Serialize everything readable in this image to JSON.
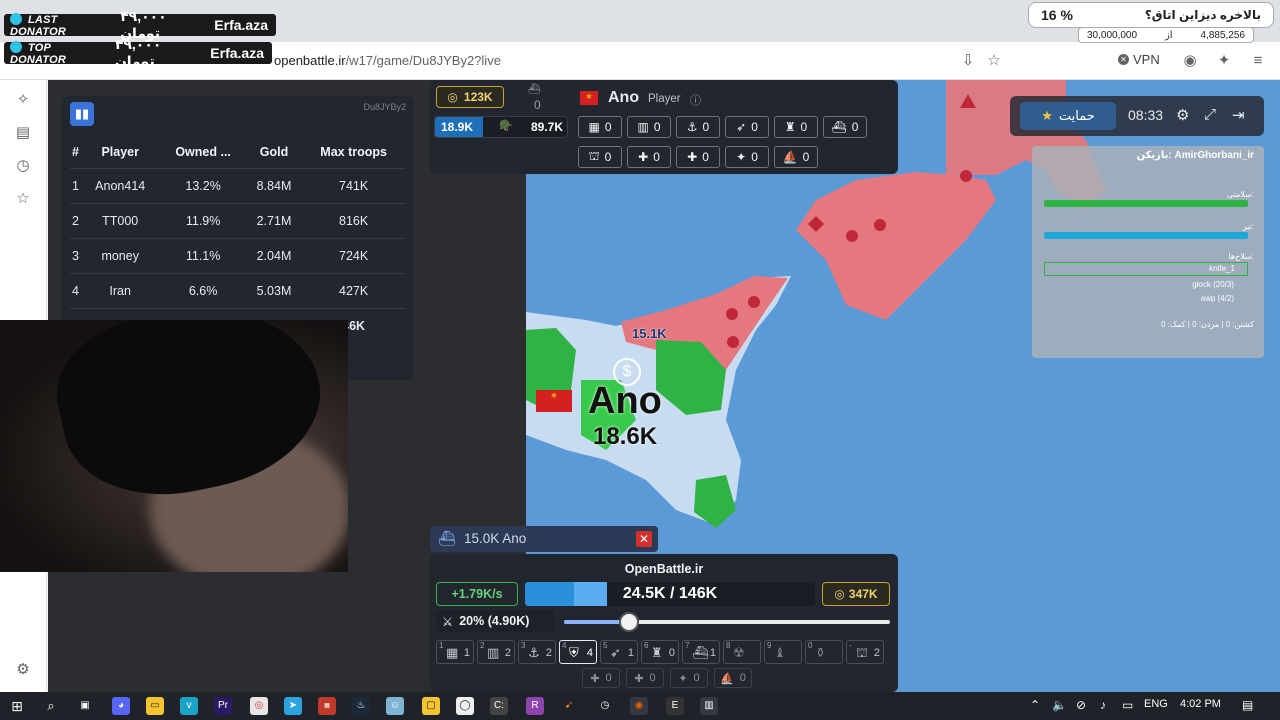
{
  "overlays": {
    "last_donator": {
      "tag": "LAST DONATOR",
      "amount": "۴۹,۰۰۰ تومان",
      "name": "Erfa.aza"
    },
    "top_donator": {
      "tag": "TOP DONATOR",
      "amount": "۴۹,۰۰۰ تومان",
      "name": "Erfa.aza"
    },
    "goal": {
      "title": "بالاخره دیزاین اتاق؟",
      "percent": "16 %",
      "current": "4,885,256",
      "of": "از",
      "target": "30,000,000"
    }
  },
  "browser": {
    "url_host": "openbattle.ir",
    "url_path": "/w17/game/Du8JYBy2?live",
    "vpn_label": "VPN"
  },
  "leaderboard": {
    "game_id": "Du8JYBy2",
    "headers": [
      "#",
      "Player",
      "Owned ...",
      "Gold",
      "Max troops"
    ],
    "rows": [
      [
        "1",
        "Anon414",
        "13.2%",
        "8.84M",
        "741K"
      ],
      [
        "2",
        "TT000",
        "11.9%",
        "2.71M",
        "816K"
      ],
      [
        "3",
        "money",
        "11.1%",
        "2.04M",
        "724K"
      ],
      [
        "4",
        "Iran",
        "6.6%",
        "5.03M",
        "427K"
      ],
      [
        "",
        "",
        "",
        "",
        "46K"
      ]
    ]
  },
  "player_info": {
    "gold": "123K",
    "boat_count": "0",
    "name": "Ano",
    "type": "Player",
    "troops_left": "18.9K",
    "troops_right": "89.7K",
    "buildings_row1": [
      "0",
      "0",
      "0",
      "0",
      "0",
      "0"
    ],
    "buildings_row2": [
      "0",
      "0",
      "0",
      "0",
      "0"
    ]
  },
  "map": {
    "player_name": "Ano",
    "player_troops": "18.6K",
    "small_troop": "15.1K"
  },
  "right_panel": {
    "player": "بازیکن: AmirGhorbani_ir",
    "health_label": "سلامتی:",
    "ammo_label": "تیر:",
    "weapons_label": "سلاح‌ها:",
    "weapon_selected": "knife_1",
    "weapon2": "glock (20/3)",
    "weapon3": "awp (4/2)",
    "stats": "کشتن: 0 | مردن: 0 | کمک: 0"
  },
  "controls": {
    "support_label": "حمایت",
    "timer": "08:33"
  },
  "attack": {
    "amount": "15.0K",
    "target": "Ano"
  },
  "bottom": {
    "brand": "OpenBattle.ir",
    "rate": "+1.79K/s",
    "troops": "24.5K / 146K",
    "troop_fraction": 0.168,
    "gold": "347K",
    "attack_ratio": "20% (4.90K)",
    "attack_percent": 20,
    "build_keys": [
      "1",
      "2",
      "3",
      "4",
      "5",
      "6",
      "7",
      "8",
      "9",
      "0",
      "-"
    ],
    "build_values": [
      "1",
      "2",
      "2",
      "4",
      "1",
      "0",
      "1",
      "",
      "",
      "",
      "2"
    ],
    "sub_values": [
      "0",
      "0",
      "0",
      "0"
    ]
  },
  "taskbar": {
    "lang": "ENG",
    "time": "4:02 PM"
  }
}
